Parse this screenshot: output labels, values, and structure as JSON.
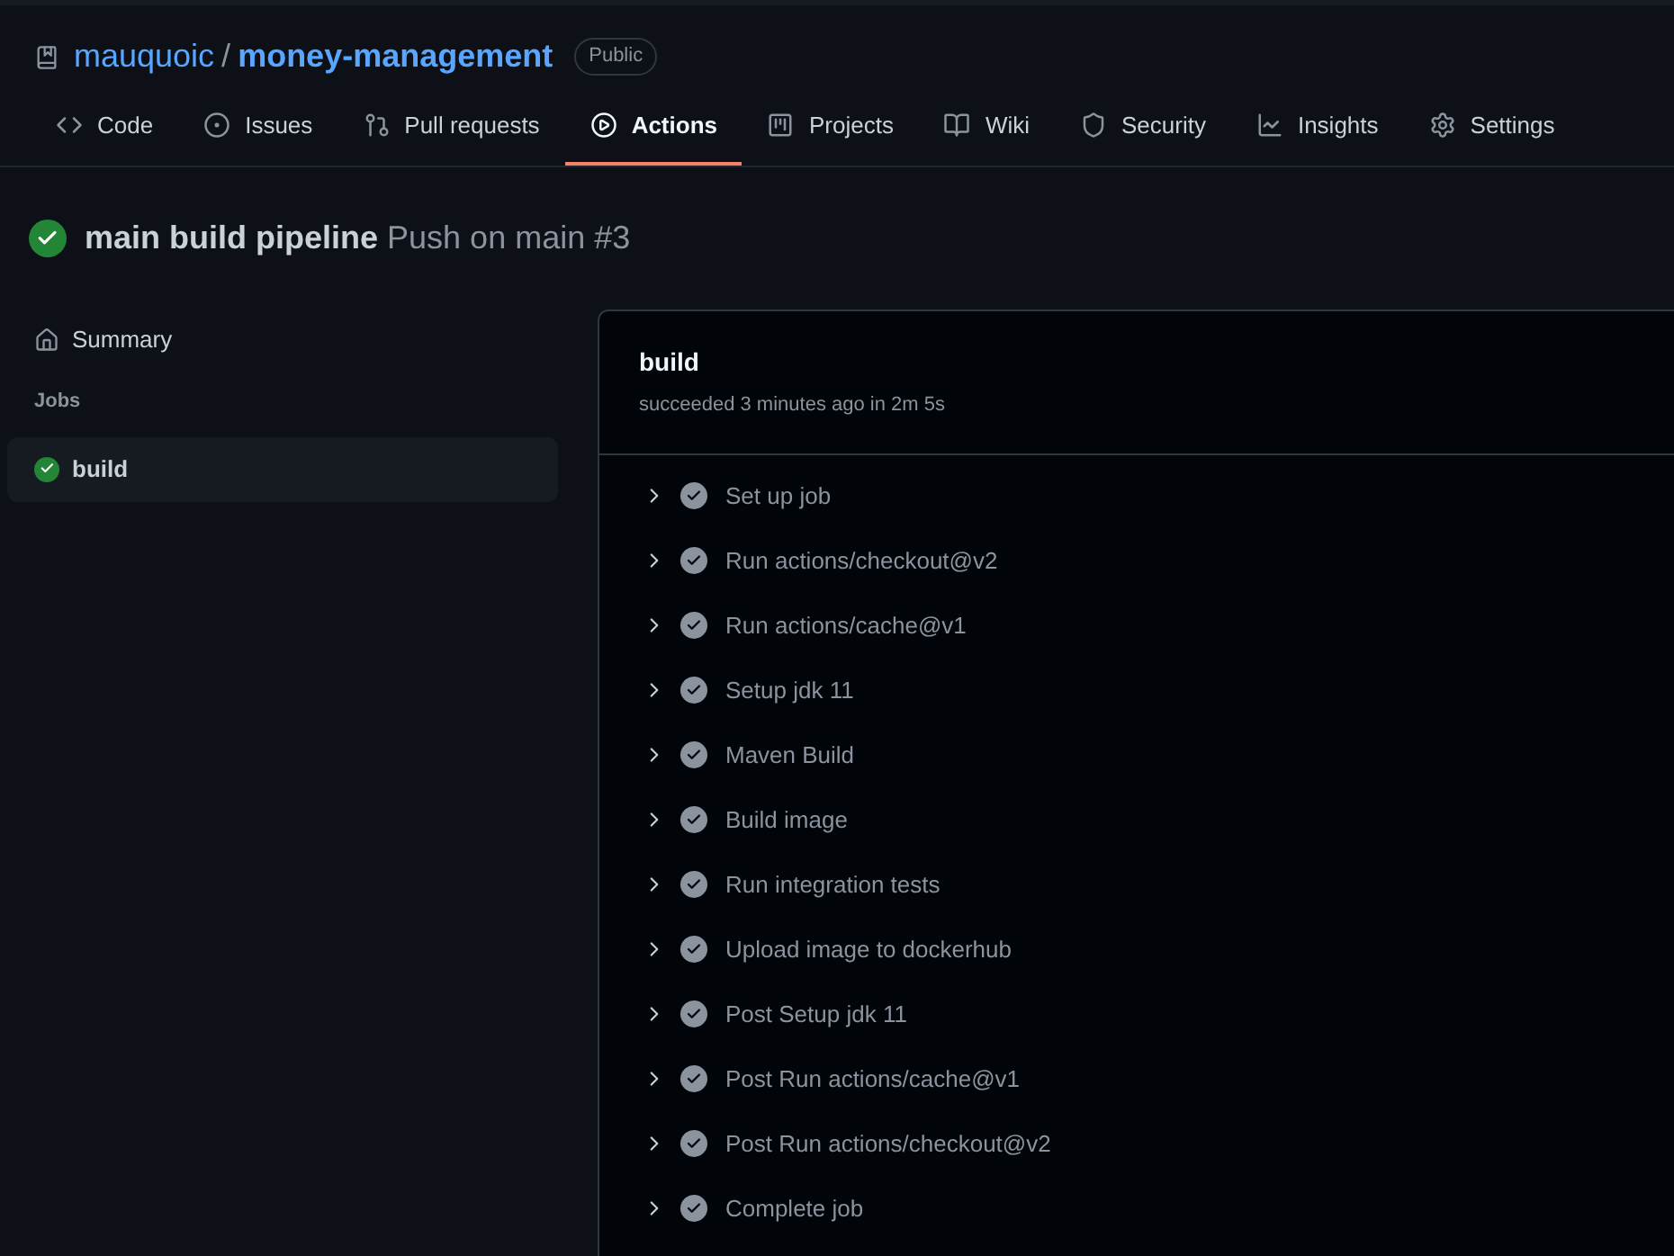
{
  "repo": {
    "owner": "mauquoic",
    "separator": "/",
    "name": "money-management",
    "visibility": "Public"
  },
  "tabs": [
    {
      "label": "Code",
      "kind": "code",
      "selected": false
    },
    {
      "label": "Issues",
      "kind": "issues",
      "selected": false
    },
    {
      "label": "Pull requests",
      "kind": "pulls",
      "selected": false
    },
    {
      "label": "Actions",
      "kind": "actions",
      "selected": true
    },
    {
      "label": "Projects",
      "kind": "projects",
      "selected": false
    },
    {
      "label": "Wiki",
      "kind": "wiki",
      "selected": false
    },
    {
      "label": "Security",
      "kind": "security",
      "selected": false
    },
    {
      "label": "Insights",
      "kind": "insights",
      "selected": false
    },
    {
      "label": "Settings",
      "kind": "settings",
      "selected": false
    }
  ],
  "run": {
    "title": "main build pipeline",
    "subtitle": "Push on main #3"
  },
  "sidebar": {
    "summary": "Summary",
    "jobs_heading": "Jobs",
    "jobs": [
      {
        "name": "build",
        "selected": true
      }
    ]
  },
  "job": {
    "name": "build",
    "status_line": "succeeded 3 minutes ago in 2m 5s",
    "steps": [
      {
        "name": "Set up job",
        "expanded": false
      },
      {
        "name": "Run actions/checkout@v2",
        "expanded": false
      },
      {
        "name": "Run actions/cache@v1",
        "expanded": false
      },
      {
        "name": "Setup jdk 11",
        "expanded": false
      },
      {
        "name": "Maven Build",
        "expanded": false
      },
      {
        "name": "Build image",
        "expanded": false
      },
      {
        "name": "Run integration tests",
        "expanded": false
      },
      {
        "name": "Upload image to dockerhub",
        "expanded": false
      },
      {
        "name": "Post Setup jdk 11",
        "expanded": false
      },
      {
        "name": "Post Run actions/cache@v1",
        "expanded": false
      },
      {
        "name": "Post Run actions/checkout@v2",
        "expanded": false
      },
      {
        "name": "Complete job",
        "expanded": false
      }
    ]
  }
}
